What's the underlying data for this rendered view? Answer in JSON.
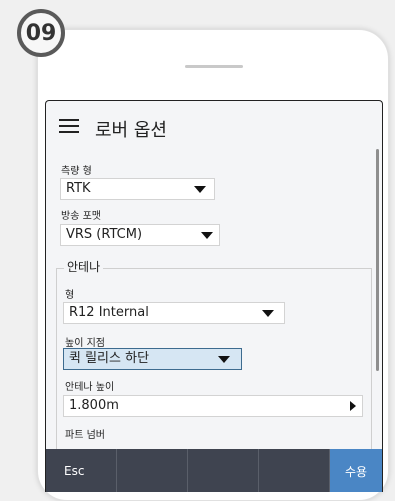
{
  "step_number": "09",
  "screen": {
    "title": "로버 옵션",
    "survey_type": {
      "label": "측량 형",
      "value": "RTK"
    },
    "broadcast_format": {
      "label": "방송 포맷",
      "value": "VRS (RTCM)"
    },
    "antenna": {
      "group_label": "안테나",
      "type": {
        "label": "형",
        "value": "R12 Internal"
      },
      "measured_to": {
        "label": "높이 지점",
        "value": "퀵 릴리스 하단"
      },
      "height": {
        "label": "안테나 높이",
        "value": "1.800m"
      },
      "part_number": {
        "label": "파트 넘버"
      }
    }
  },
  "bottom_bar": {
    "esc_label": "Esc",
    "accept_label": "수용"
  },
  "colors": {
    "accent": "#4a86c5",
    "bar": "#3f4450",
    "selected_bg": "#d6e6f3"
  }
}
